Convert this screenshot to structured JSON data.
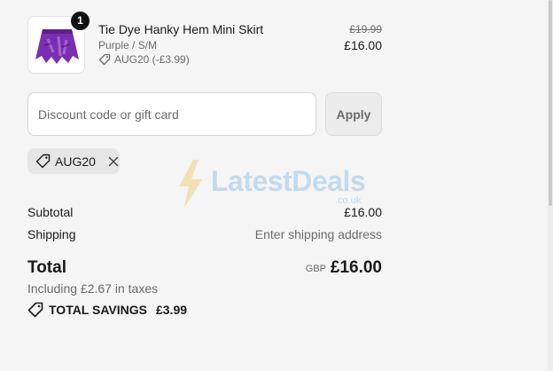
{
  "product": {
    "quantity": "1",
    "title": "Tie Dye Hanky Hem Mini Skirt",
    "variant": "Purple / S/M",
    "discount_note": "AUG20 (-£3.99)",
    "price_original": "£19.99",
    "price_current": "£16.00",
    "image_icon": "skirt-image"
  },
  "discount": {
    "placeholder": "Discount code or gift card",
    "value": "",
    "apply_label": "Apply",
    "applied_code": "AUG20"
  },
  "watermark": {
    "text": "LatestDeals",
    "subtext": ".co.uk"
  },
  "summary": {
    "subtotal_label": "Subtotal",
    "subtotal_value": "£16.00",
    "shipping_label": "Shipping",
    "shipping_value": "Enter shipping address",
    "total_label": "Total",
    "currency": "GBP",
    "total_value": "£16.00",
    "taxes_note": "Including £2.67 in taxes",
    "savings_label": "TOTAL SAVINGS",
    "savings_value": "£3.99"
  },
  "colors": {
    "background": "#f5f5f5",
    "text": "#1a1a1a",
    "muted": "#6b6b6b",
    "skirt": "#7b2fb0"
  }
}
